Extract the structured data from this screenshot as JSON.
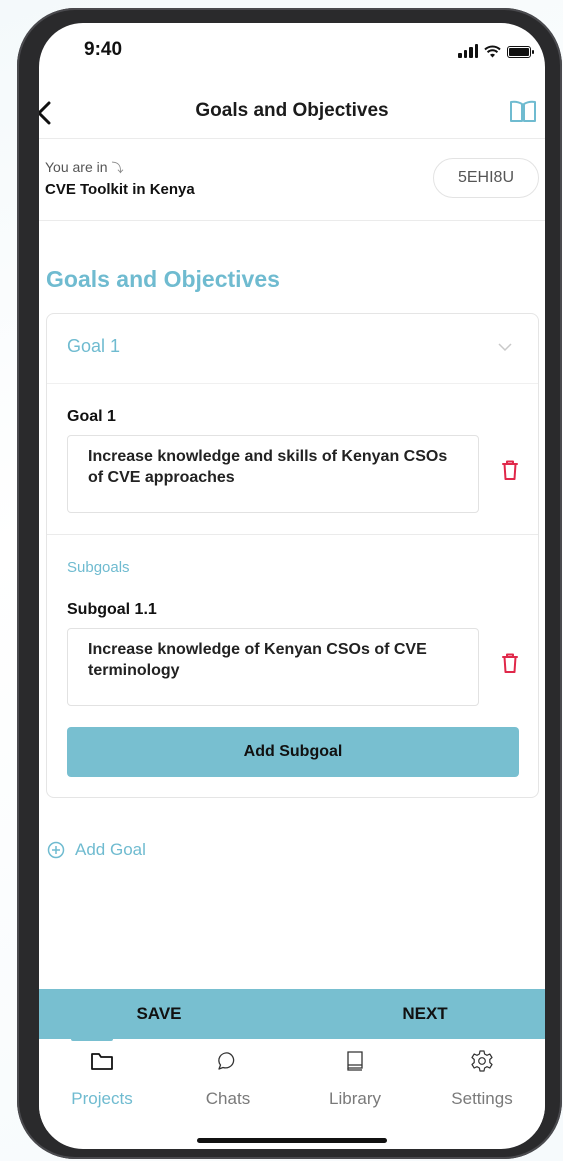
{
  "status": {
    "time": "9:40"
  },
  "nav": {
    "title": "Goals and Objectives",
    "back_icon": "chevron-left-icon",
    "guide_icon": "book-open-icon"
  },
  "project": {
    "location_label": "You are in",
    "name": "CVE Toolkit in Kenya",
    "code": "5EHI8U"
  },
  "section_title": "Goals and Objectives",
  "goal_card": {
    "header": "Goal 1",
    "goal_label": "Goal 1",
    "goal_text": "Increase knowledge and skills of Kenyan CSOs of CVE approaches",
    "subgoals_heading": "Subgoals",
    "subgoal_label": "Subgoal 1.1",
    "subgoal_text": "Increase knowledge of Kenyan CSOs of CVE terminology",
    "add_subgoal_label": "Add Subgoal"
  },
  "add_goal_label": "Add Goal",
  "actions": {
    "save": "SAVE",
    "next": "NEXT"
  },
  "tabs": [
    {
      "label": "Projects",
      "icon": "folder-icon",
      "active": true
    },
    {
      "label": "Chats",
      "icon": "chat-bubble-icon",
      "active": false
    },
    {
      "label": "Library",
      "icon": "book-icon",
      "active": false
    },
    {
      "label": "Settings",
      "icon": "gear-icon",
      "active": false
    }
  ],
  "colors": {
    "accent": "#6fbbd0",
    "button": "#78bfd0",
    "delete": "#e0284a"
  }
}
